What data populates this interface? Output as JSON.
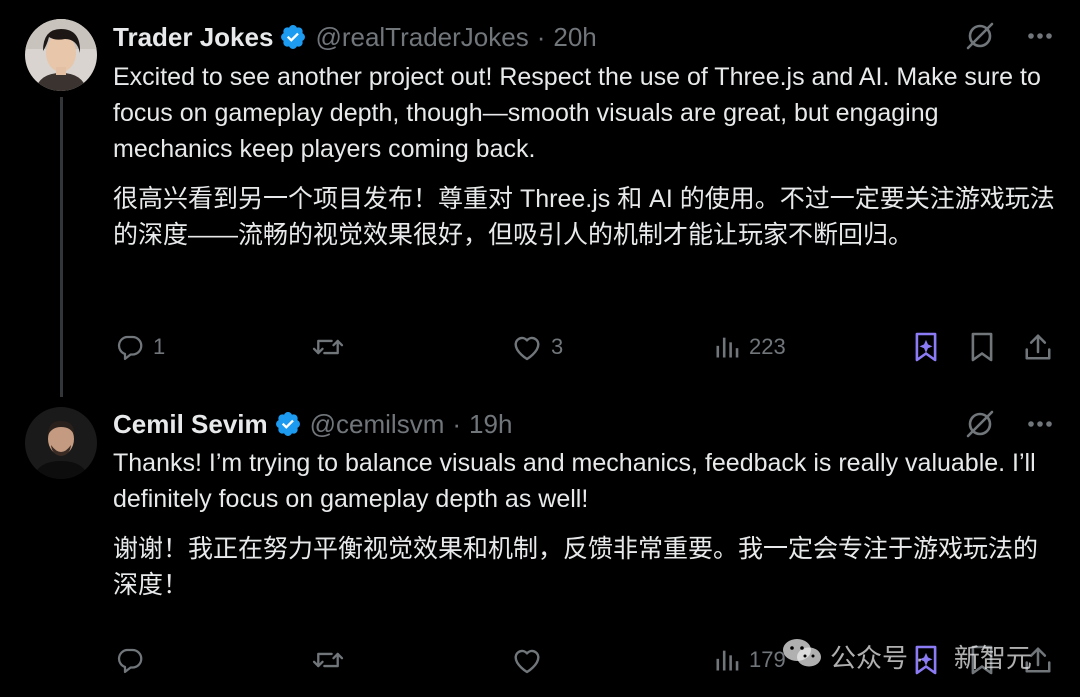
{
  "tweets": [
    {
      "name": "Trader Jokes",
      "handle": "@realTraderJokes",
      "time": "20h",
      "text_en": "Excited to see another project out! Respect the use of Three.js and AI. Make sure to focus on gameplay depth, though—smooth visuals are great, but engaging mechanics keep players coming back.",
      "text_zh": "很高兴看到另一个项目发布！尊重对 Three.js 和 AI 的使用。不过一定要关注游戏玩法的深度——流畅的视觉效果很好，但吸引人的机制才能让玩家不断回归。",
      "replies": "1",
      "retweets": "",
      "likes": "3",
      "views": "223"
    },
    {
      "name": "Cemil Sevim",
      "handle": "@cemilsvm",
      "time": "19h",
      "text_en": "Thanks! I’m trying to balance visuals and mechanics, feedback is really valuable. I’ll definitely focus on gameplay depth as well!",
      "text_zh": "谢谢！我正在努力平衡视觉效果和机制，反馈非常重要。我一定会专注于游戏玩法的深度！",
      "replies": "",
      "retweets": "",
      "likes": "",
      "views": "179"
    }
  ],
  "separator": "·",
  "watermark": {
    "text1": "公众号 ·",
    "text2": "新智元"
  },
  "colors": {
    "background": "#000000",
    "text": "#e7e9ea",
    "muted": "#71767b",
    "verified": "#1d9bf0",
    "grok": "#8b7cf6"
  }
}
